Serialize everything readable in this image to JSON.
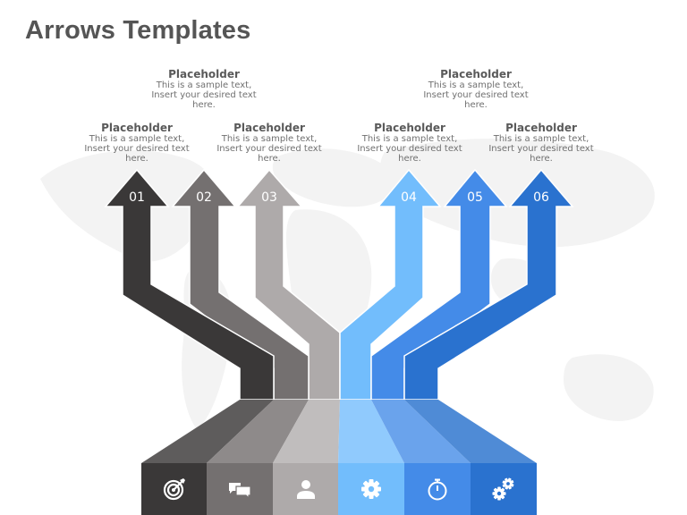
{
  "title": "Arrows Templates",
  "steps": [
    {
      "number": "01",
      "caption_title": "Placeholder",
      "caption_text": "This is a sample text, Insert your desired text here.",
      "icon": "target-icon",
      "color": "#3a3838",
      "plane_color": "#5e5c5c"
    },
    {
      "number": "02",
      "caption_title": "Placeholder",
      "caption_text": "This is a sample text, Insert your desired text here.",
      "icon": "chat-bubbles-icon",
      "color": "#747070",
      "plane_color": "#8e8a8a"
    },
    {
      "number": "03",
      "caption_title": "Placeholder",
      "caption_text": "This is a sample text, Insert your desired text here.",
      "icon": "user-icon",
      "color": "#aeaaaa",
      "plane_color": "#c0bdbd"
    },
    {
      "number": "04",
      "caption_title": "Placeholder",
      "caption_text": "This is a sample text, Insert your desired text here.",
      "icon": "gear-icon",
      "color": "#72bdfc",
      "plane_color": "#90cafd"
    },
    {
      "number": "05",
      "caption_title": "Placeholder",
      "caption_text": "This is a sample text, Insert your desired text here.",
      "icon": "stopwatch-icon",
      "color": "#448be8",
      "plane_color": "#6aa3ec"
    },
    {
      "number": "06",
      "caption_title": "Placeholder",
      "caption_text": "This is a sample text, Insert your desired text here.",
      "icon": "gears-icon",
      "color": "#2a72cf",
      "plane_color": "#4f8bd6"
    }
  ],
  "background_color": "#ffffff",
  "map_color": "#f3f3f3"
}
